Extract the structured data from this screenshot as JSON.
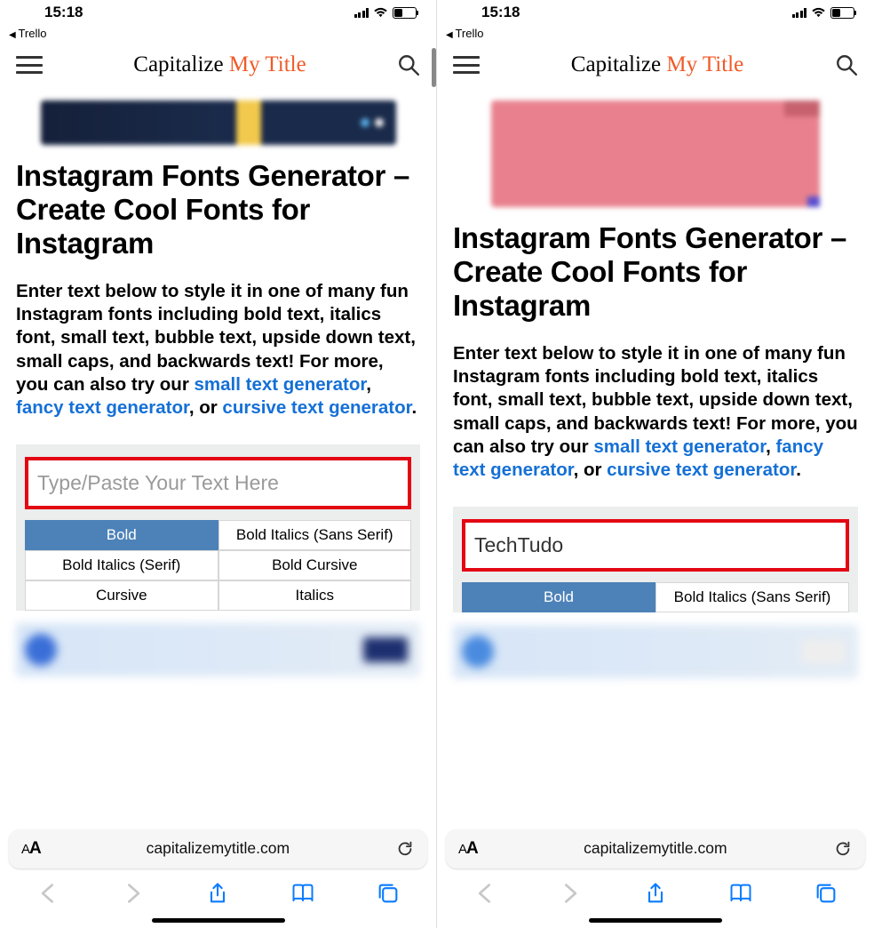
{
  "status": {
    "time": "15:18",
    "back_app": "Trello"
  },
  "brand": {
    "part1": "Capitalize ",
    "part2": "My Title"
  },
  "page": {
    "title": "Instagram Fonts Generator – Create Cool Fonts for Instagram",
    "intro_pre": "Enter text below to style it in one of many fun Instagram fonts including bold text, italics font, small text, bubble text, upside down text, small caps, and backwards text! For more, you can also try our ",
    "link1": "small text generator",
    "intro_sep1": ", ",
    "link2": "fancy text generator",
    "intro_sep2": ", or ",
    "link3": "cursive text generator",
    "intro_end": "."
  },
  "tool": {
    "placeholder": "Type/Paste Your Text Here",
    "input_value_left": "",
    "input_value_right": "TechTudo",
    "tabs": [
      "Bold",
      "Bold Italics (Sans Serif)",
      "Bold Italics (Serif)",
      "Bold Cursive",
      "Cursive",
      "Italics"
    ],
    "active_tab": "Bold"
  },
  "browser": {
    "url": "capitalizemytitle.com"
  }
}
